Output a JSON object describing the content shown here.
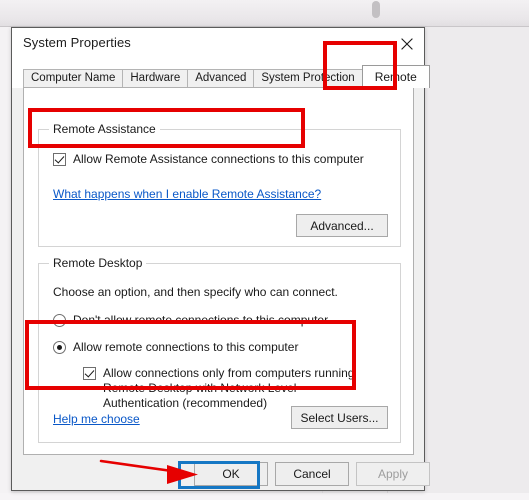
{
  "window": {
    "title": "System Properties",
    "close_icon": "close-x-icon"
  },
  "tabs": [
    {
      "label": "Computer Name",
      "active": false
    },
    {
      "label": "Hardware",
      "active": false
    },
    {
      "label": "Advanced",
      "active": false
    },
    {
      "label": "System Protection",
      "active": false
    },
    {
      "label": "Remote",
      "active": true
    }
  ],
  "remote_assistance": {
    "legend": "Remote Assistance",
    "checkbox_label": "Allow Remote Assistance connections to this computer",
    "checkbox_checked": true,
    "link_label": "What happens when I enable Remote Assistance?",
    "advanced_button": "Advanced..."
  },
  "remote_desktop": {
    "legend": "Remote Desktop",
    "instruction": "Choose an option, and then specify who can connect.",
    "options": [
      {
        "label": "Don't allow remote connections to this computer",
        "selected": false
      },
      {
        "label": "Allow remote connections to this computer",
        "selected": true
      }
    ],
    "nla_checkbox_label": "Allow connections only from computers running Remote Desktop with Network Level Authentication (recommended)",
    "nla_checkbox_checked": true,
    "link_label": "Help me choose",
    "select_users_button": "Select Users..."
  },
  "footer": {
    "ok_label": "OK",
    "cancel_label": "Cancel",
    "apply_label": "Apply",
    "apply_disabled": true
  },
  "annotations": {
    "highlight_color": "#e60000",
    "ok_highlight_color": "#1577c4",
    "arrow_color": "#e60000",
    "arrow_target": "OK"
  }
}
